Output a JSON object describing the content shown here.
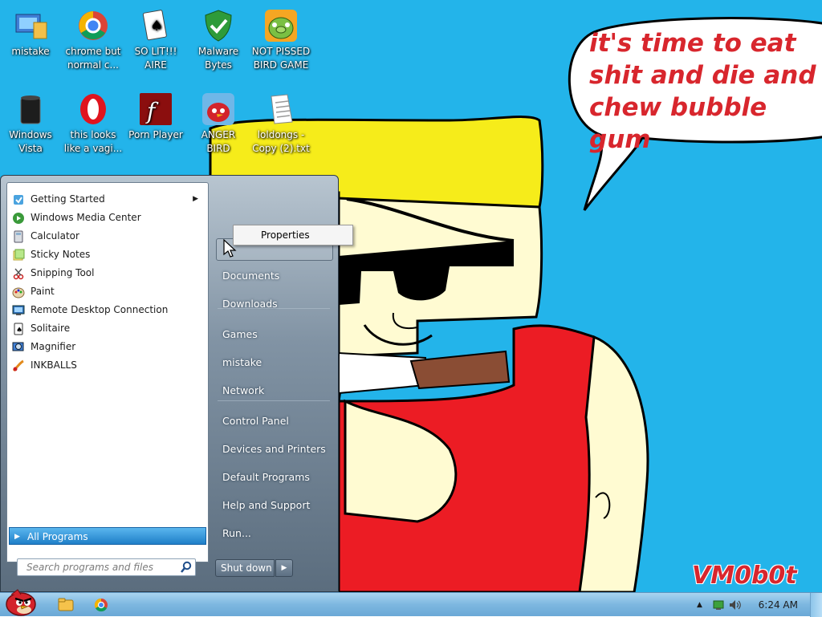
{
  "desktop": {
    "icons": [
      {
        "label": "mistake",
        "icon": "monitor-folder-icon"
      },
      {
        "label": "chrome but\nnormal c...",
        "icon": "chrome-icon"
      },
      {
        "label": "SO LIT!!!\nAIRE",
        "icon": "solitaire-icon"
      },
      {
        "label": "Malware\nBytes",
        "icon": "shield-icon"
      },
      {
        "label": "NOT PISSED\nBIRD GAME",
        "icon": "pig-icon"
      },
      {
        "label": "Windows\nVista",
        "icon": "trash-icon"
      },
      {
        "label": "this looks\nlike a vagi...",
        "icon": "opera-icon"
      },
      {
        "label": "Porn Player",
        "icon": "flash-icon"
      },
      {
        "label": "ANGER\nBIRD",
        "icon": "angry-bird-icon"
      },
      {
        "label": "loldongs -\nCopy (2).txt",
        "icon": "text-file-icon"
      }
    ],
    "speech_text": "it's time to eat shit and die and chew bubble gum",
    "watermark": "VM0b0t"
  },
  "start_menu": {
    "programs": [
      {
        "label": "Getting Started",
        "has_submenu": true,
        "icon": "getting-started-icon"
      },
      {
        "label": "Windows Media Center",
        "icon": "media-center-icon"
      },
      {
        "label": "Calculator",
        "icon": "calculator-icon"
      },
      {
        "label": "Sticky Notes",
        "icon": "sticky-notes-icon"
      },
      {
        "label": "Snipping Tool",
        "icon": "scissors-icon"
      },
      {
        "label": "Paint",
        "icon": "paint-icon"
      },
      {
        "label": "Remote Desktop Connection",
        "icon": "remote-desktop-icon"
      },
      {
        "label": "Solitaire",
        "icon": "solitaire-icon"
      },
      {
        "label": "Magnifier",
        "icon": "magnifier-icon"
      },
      {
        "label": "INKBALLS",
        "icon": "inkball-icon"
      }
    ],
    "all_programs": "All Programs",
    "search_placeholder": "Search programs and files",
    "right_items": [
      {
        "label": "Documents"
      },
      {
        "label": "Downloads"
      },
      {
        "label": "Games"
      },
      {
        "label": "mistake"
      },
      {
        "label": "Network"
      },
      {
        "label": "Control Panel"
      },
      {
        "label": "Devices and Printers"
      },
      {
        "label": "Default Programs"
      },
      {
        "label": "Help and Support"
      },
      {
        "label": "Run..."
      }
    ],
    "shutdown": "Shut down"
  },
  "context_menu": {
    "items": [
      "Properties"
    ]
  },
  "taskbar": {
    "clock": "6:24 AM",
    "apps": [
      "explorer-icon",
      "chrome-icon"
    ]
  }
}
